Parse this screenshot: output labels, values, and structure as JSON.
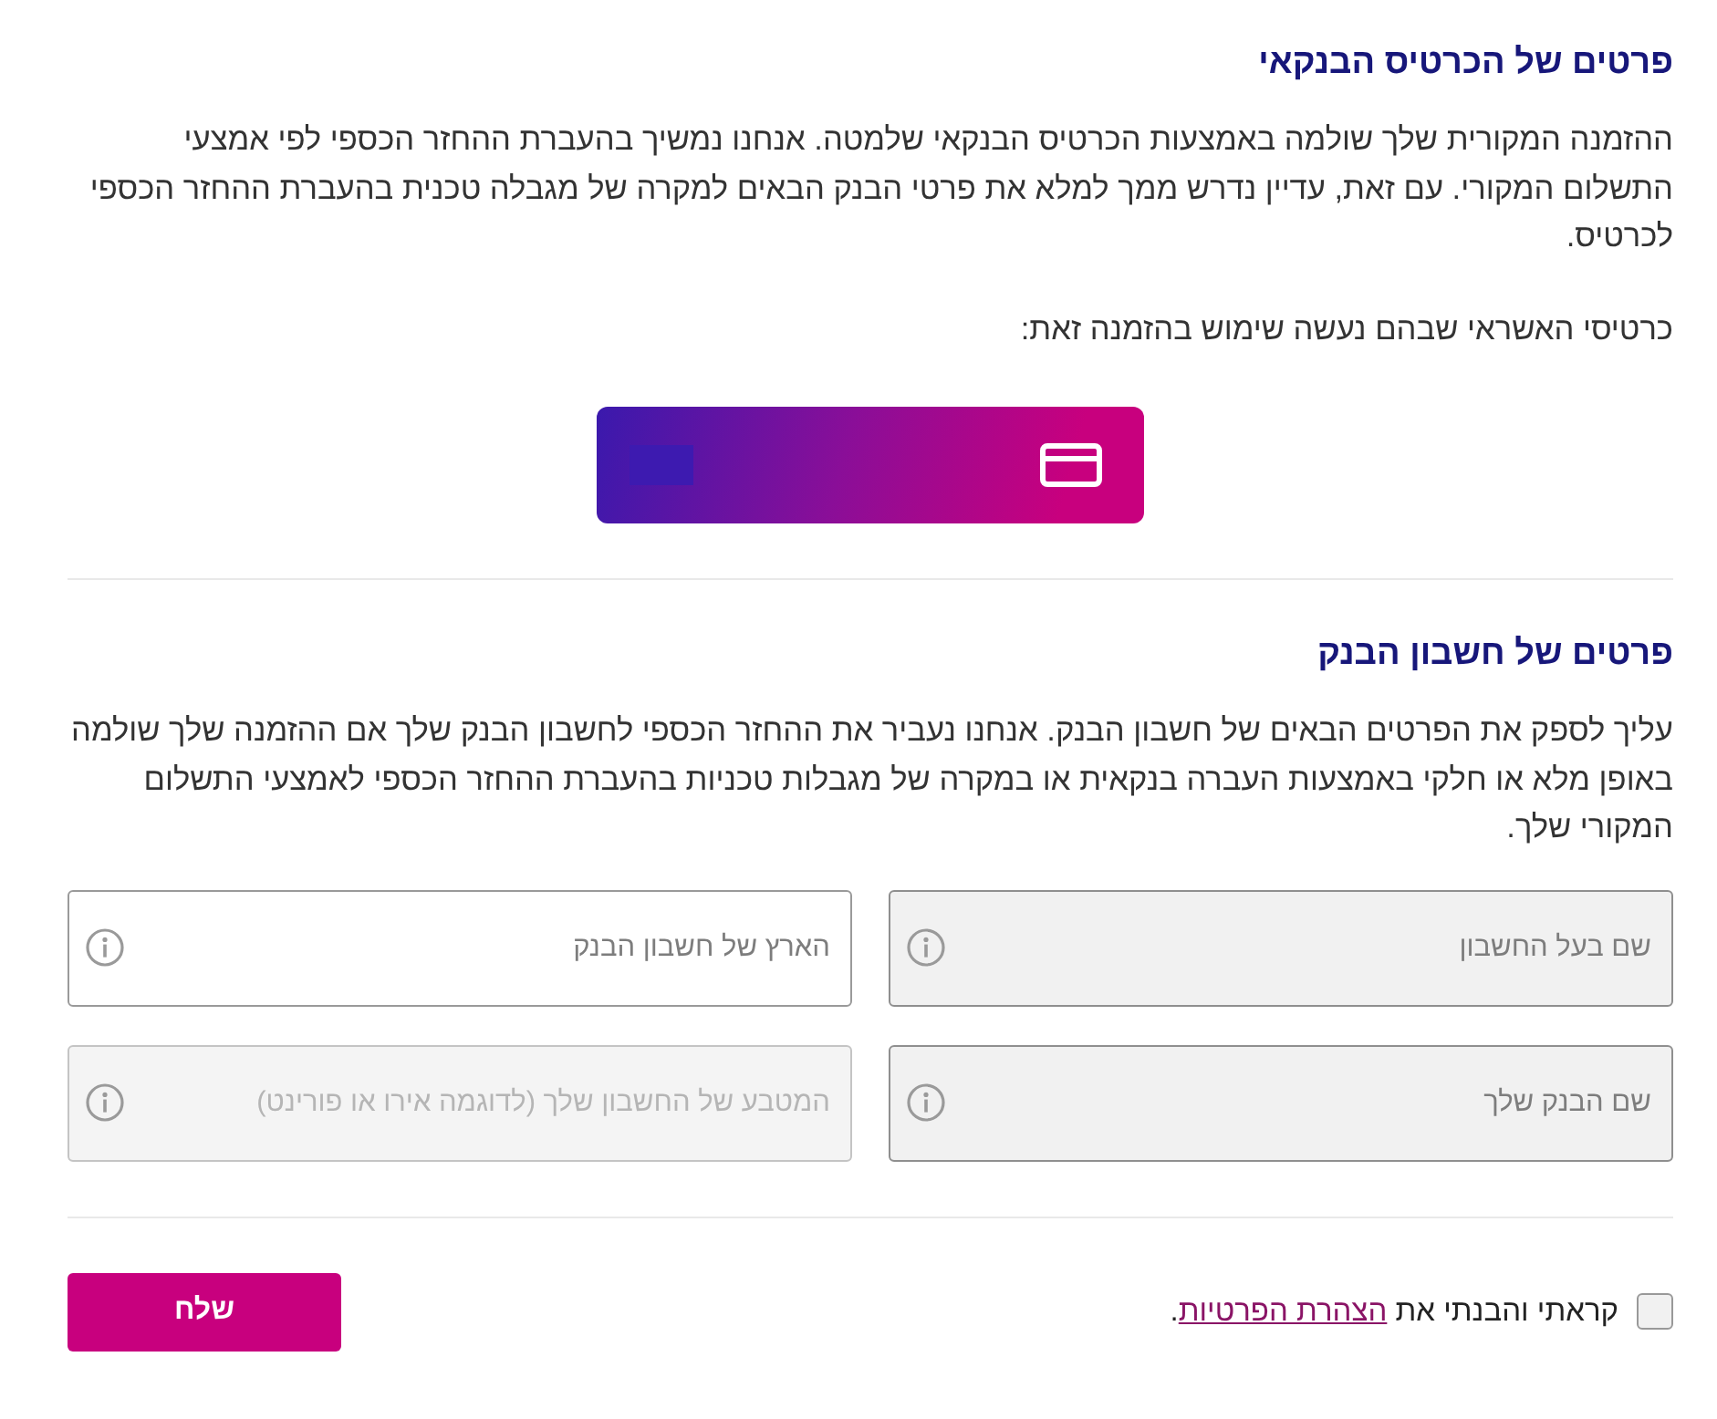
{
  "card_section": {
    "title": "פרטים של הכרטיס הבנקאי",
    "paragraph": "ההזמנה המקורית שלך שולמה באמצעות הכרטיס הבנקאי שלמטה. אנחנו נמשיך בהעברת ההחזר הכספי לפי אמצעי התשלום המקורי. עם זאת, עדיין נדרש ממך למלא את פרטי הבנק הבאים למקרה של מגבלה טכנית בהעברת ההחזר הכספי לכרטיס.",
    "cards_label": "כרטיסי האשראי שבהם נעשה שימוש בהזמנה זאת:"
  },
  "bank_section": {
    "title": "פרטים של חשבון הבנק",
    "paragraph": "עליך לספק את הפרטים הבאים של חשבון הבנק. אנחנו נעביר את ההחזר הכספי לחשבון הבנק שלך אם ההזמנה שלך שולמה באופן מלא או חלקי באמצעות העברה בנקאית או במקרה של מגבלות טכניות בהעברת ההחזר הכספי לאמצעי התשלום המקורי שלך.",
    "fields": [
      {
        "placeholder": "שם בעל החשבון",
        "readonly": true,
        "disabled": false
      },
      {
        "placeholder": "הארץ של חשבון הבנק",
        "readonly": false,
        "disabled": false
      },
      {
        "placeholder": "שם הבנק שלך",
        "readonly": true,
        "disabled": false
      },
      {
        "placeholder": "המטבע של החשבון שלך (לדוגמה אירו או פורינט)",
        "readonly": false,
        "disabled": true
      }
    ]
  },
  "consent": {
    "checked": false,
    "text": "קראתי והבנתי את",
    "link": "הצהרת הפרטיות",
    "after": "."
  },
  "submit_button": "שלח"
}
